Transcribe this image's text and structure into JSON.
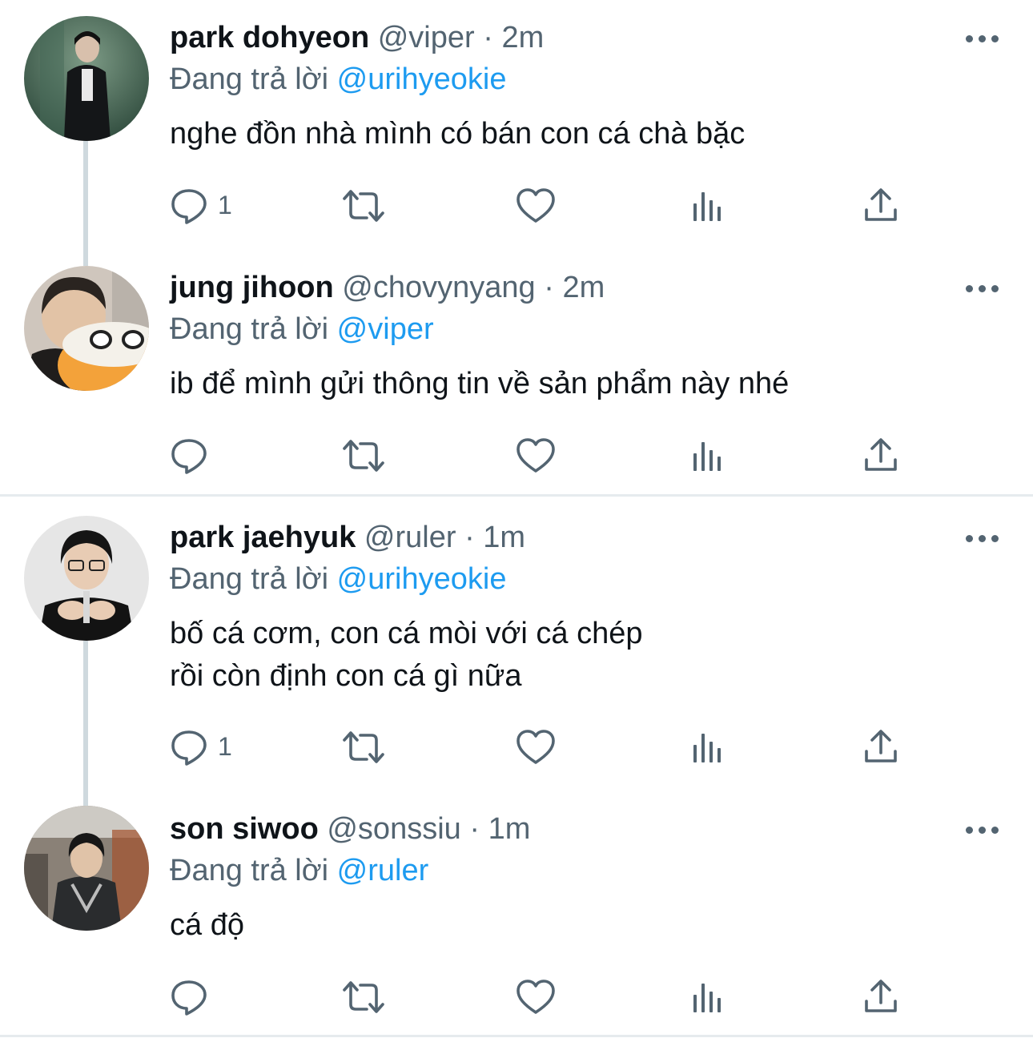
{
  "replying_label": "Đang trả lời",
  "tweets": [
    {
      "name": "park dohyeon",
      "handle": "@viper",
      "separator": "·",
      "time": "2m",
      "reply_to": "@urihyeokie",
      "text": "nghe đồn nhà mình có bán con cá chà bặc",
      "reply_count": "1"
    },
    {
      "name": "jung jihoon",
      "handle": "@chovynyang",
      "separator": "·",
      "time": "2m",
      "reply_to": "@viper",
      "text": "ib để mình gửi thông tin về sản phẩm này nhé",
      "reply_count": ""
    },
    {
      "name": "park jaehyuk",
      "handle": "@ruler",
      "separator": "·",
      "time": "1m",
      "reply_to": "@urihyeokie",
      "text": "bố cá cơm, con cá mòi với cá chép\nrồi còn định con cá gì nữa",
      "reply_count": "1"
    },
    {
      "name": "son siwoo",
      "handle": "@sonssiu",
      "separator": "·",
      "time": "1m",
      "reply_to": "@ruler",
      "text": "cá độ",
      "reply_count": ""
    }
  ],
  "colors": {
    "text": "#0f1419",
    "secondary": "#536471",
    "link": "#1d9bf0",
    "thread_line": "#cfd9de",
    "divider": "#e6ebee"
  },
  "icons": [
    "reply-icon",
    "retweet-icon",
    "like-icon",
    "views-icon",
    "share-icon",
    "more-icon"
  ]
}
